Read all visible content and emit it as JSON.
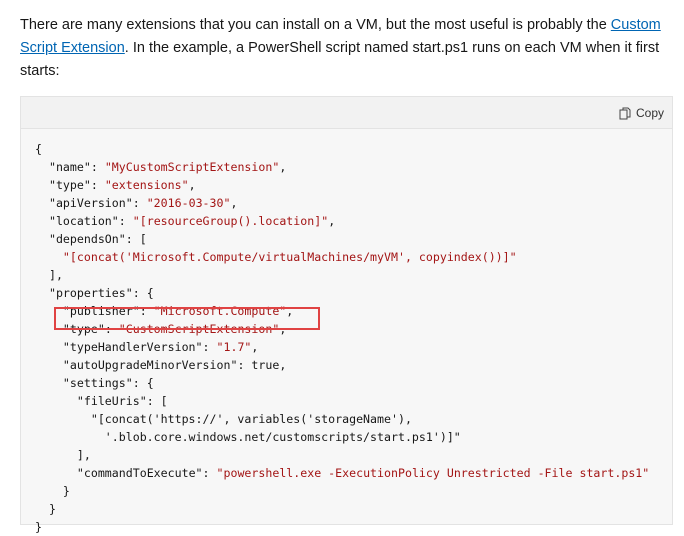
{
  "intro": {
    "text_before_link": "There are many extensions that you can install on a VM, but the most useful is probably the ",
    "link_text": "Custom Script Extension",
    "text_after_link": ". In the example, a PowerShell script named start.ps1 runs on each VM when it first starts:"
  },
  "code_block": {
    "copy_label": "Copy",
    "copy_icon": "copy-icon",
    "lines": [
      "{",
      "  \"name\": \"MyCustomScriptExtension\",",
      "  \"type\": \"extensions\",",
      "  \"apiVersion\": \"2016-03-30\",",
      "  \"location\": \"[resourceGroup().location]\",",
      "  \"dependsOn\": [",
      "    \"[concat('Microsoft.Compute/virtualMachines/myVM', copyindex())]\"",
      "  ],",
      "  \"properties\": {",
      "    \"publisher\": \"Microsoft.Compute\",",
      "    \"type\": \"CustomScriptExtension\",",
      "    \"typeHandlerVersion\": \"1.7\",",
      "    \"autoUpgradeMinorVersion\": true,",
      "    \"settings\": {",
      "      \"fileUris\": [",
      "        \"[concat('https://', variables('storageName'),",
      "          '.blob.core.windows.net/customscripts/start.ps1')]\"",
      "      ],",
      "      \"commandToExecute\": \"powershell.exe -ExecutionPolicy Unrestricted -File start.ps1\"",
      "    }",
      "  }",
      "}"
    ]
  },
  "colors": {
    "link": "#0065b3",
    "highlight_border": "#e04343",
    "string": "#a31515"
  }
}
